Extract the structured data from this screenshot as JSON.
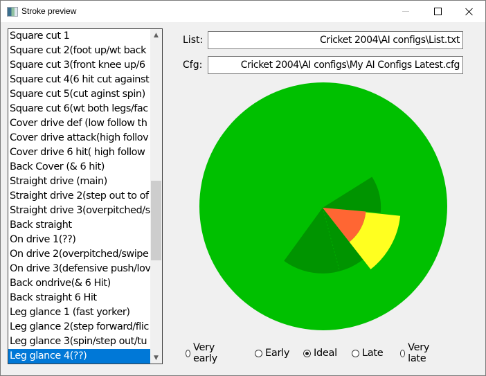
{
  "window": {
    "title": "Stroke preview",
    "controls": {
      "minimize": "minimize",
      "maximize": "maximize",
      "close": "close"
    }
  },
  "stroke_list": {
    "items": [
      "Square cut 1",
      "Square cut 2(foot up/wt back",
      "Square cut 3(front knee up/6",
      "Square cut 4(6 hit cut against",
      "Square cut 5(cut aginst spin)",
      "Square cut 6(wt both legs/fac",
      "Cover drive def (low follow th",
      "Cover drive attack(high follov",
      "Cover drive 6 hit( high follow",
      "Back Cover (& 6 hit)",
      "Straight drive (main)",
      "Straight drive 2(step out to of",
      "Straight drive 3(overpitched/s",
      "Back straight",
      "On drive 1(??)",
      "On drive 2(overpitched/swipe",
      "On drive 3(defensive push/lov",
      "Back ondrive(& 6 Hit)",
      "Back straight 6 Hit",
      "Leg glance 1 (fast yorker)",
      "Leg glance 2(step forward/flic",
      "Leg glance 3(spin/step out/tu",
      "Leg glance 4(??)"
    ],
    "selected_index": 22,
    "scroll_up": "^",
    "scroll_down": "v"
  },
  "fields": {
    "list_label": "List:",
    "list_value": "Cricket 2004\\AI configs\\List.txt",
    "cfg_label": "Cfg:",
    "cfg_value": "Cricket 2004\\AI configs\\My AI Configs Latest.cfg"
  },
  "timing": {
    "options": [
      "Very early",
      "Early",
      "Ideal",
      "Late",
      "Very late"
    ],
    "selected": "Ideal"
  },
  "chart_data": {
    "type": "pie",
    "title": "",
    "description": "Shot direction wheel; background field disc with highlighted wedge sectors (angles in degrees, 0 = right/east, clockwise positive; radius as fraction of field radius)",
    "field": {
      "color": "#00c000"
    },
    "sectors": [
      {
        "name": "stroke-range-upper",
        "start_deg": -32,
        "end_deg": 5,
        "radius_frac": 0.47,
        "color": "#009400"
      },
      {
        "name": "stroke-range-lower",
        "start_deg": 52,
        "end_deg": 126,
        "radius_frac": 0.53,
        "color": "#009400"
      },
      {
        "name": "ideal-region",
        "start_deg": 6,
        "end_deg": 52,
        "inner_frac": 0.35,
        "radius_frac": 0.63,
        "color": "#ffff20"
      },
      {
        "name": "core-region",
        "start_deg": 5,
        "end_deg": 52,
        "radius_frac": 0.35,
        "color": "#ff6633"
      }
    ],
    "divider_deg": 75
  }
}
